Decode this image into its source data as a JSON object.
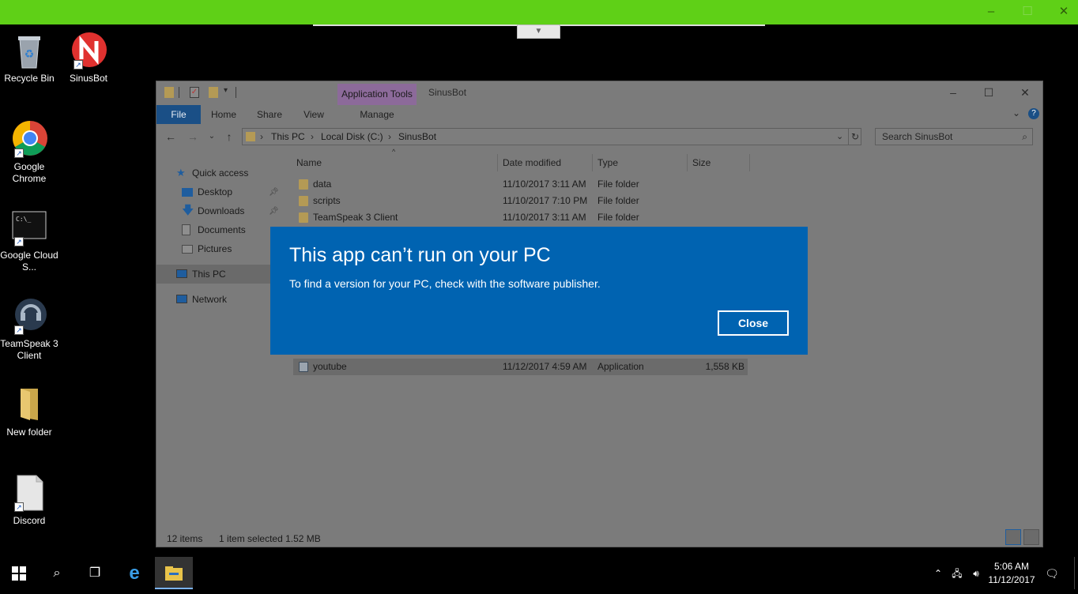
{
  "remote_bar": {
    "minimize": "‒",
    "maximize": "☐",
    "close": "✕",
    "accent": "#5fd017"
  },
  "desktop": {
    "icons": [
      {
        "label": "Recycle Bin"
      },
      {
        "label": "SinusBot"
      },
      {
        "label": "Google Chrome"
      },
      {
        "label": "Google Cloud S..."
      },
      {
        "label": "TeamSpeak 3 Client"
      },
      {
        "label": "New folder"
      },
      {
        "label": "Discord"
      }
    ]
  },
  "explorer": {
    "context_tab": "Application Tools",
    "window_title": "SinusBot",
    "ribbon": {
      "file": "File",
      "home": "Home",
      "share": "Share",
      "view": "View",
      "manage": "Manage"
    },
    "breadcrumb": [
      "This PC",
      "Local Disk (C:)",
      "SinusBot"
    ],
    "search_placeholder": "Search SinusBot",
    "nav": {
      "quick_access": "Quick access",
      "desktop": "Desktop",
      "downloads": "Downloads",
      "documents": "Documents",
      "pictures": "Pictures",
      "this_pc": "This PC",
      "network": "Network"
    },
    "columns": {
      "name": "Name",
      "date": "Date modified",
      "type": "Type",
      "size": "Size"
    },
    "rows": [
      {
        "name": "data",
        "date": "11/10/2017 3:11 AM",
        "type": "File folder",
        "size": ""
      },
      {
        "name": "scripts",
        "date": "11/10/2017 7:10 PM",
        "type": "File folder",
        "size": ""
      },
      {
        "name": "TeamSpeak 3 Client",
        "date": "11/10/2017 3:11 AM",
        "type": "File folder",
        "size": ""
      },
      {
        "name": "youtube",
        "date": "11/12/2017 4:59 AM",
        "type": "Application",
        "size": "1,558 KB"
      }
    ],
    "status_count": "12 items",
    "status_selection": "1 item selected  1.52 MB"
  },
  "dialog": {
    "title": "This app can’t run on your PC",
    "message": "To find a version for your PC, check with the software publisher.",
    "close_label": "Close",
    "color": "#0063b1"
  },
  "taskbar": {
    "time": "5:06 AM",
    "date": "11/12/2017"
  }
}
